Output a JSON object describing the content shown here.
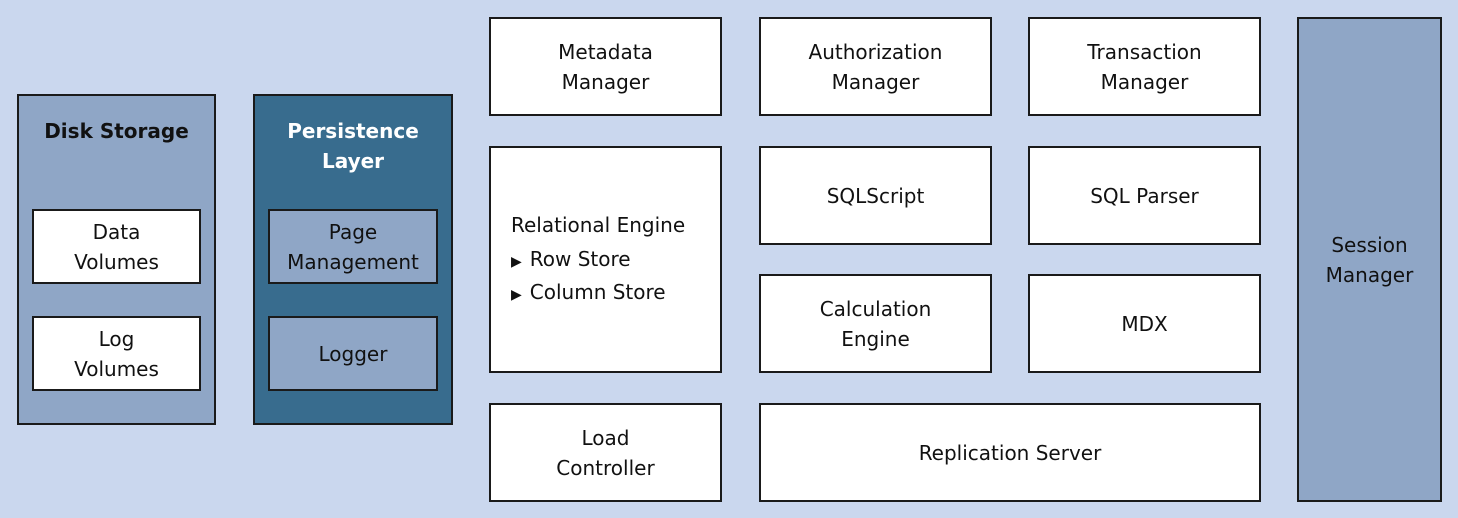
{
  "disk_storage": {
    "title": "Disk Storage",
    "items": [
      "Data\nVolumes",
      "Log\nVolumes"
    ]
  },
  "persistence_layer": {
    "title": "Persistence\nLayer",
    "items": [
      "Page\nManagement",
      "Logger"
    ]
  },
  "components": {
    "metadata_manager": "Metadata\nManager",
    "authorization_manager": "Authorization\nManager",
    "transaction_manager": "Transaction\nManager",
    "relational_engine": {
      "title": "Relational Engine",
      "bullet_icon": "triangle-right-icon",
      "items": [
        "Row Store",
        "Column Store"
      ]
    },
    "sqlscript": "SQLScript",
    "sql_parser": "SQL Parser",
    "calculation_engine": "Calculation\nEngine",
    "mdx": "MDX",
    "load_controller": "Load\nController",
    "replication_server": "Replication Server",
    "session_manager": "Session\nManager"
  },
  "colors": {
    "background": "#cad7ee",
    "mid_blue": "#8fa6c6",
    "dark_blue": "#386c8e",
    "white": "#ffffff"
  }
}
